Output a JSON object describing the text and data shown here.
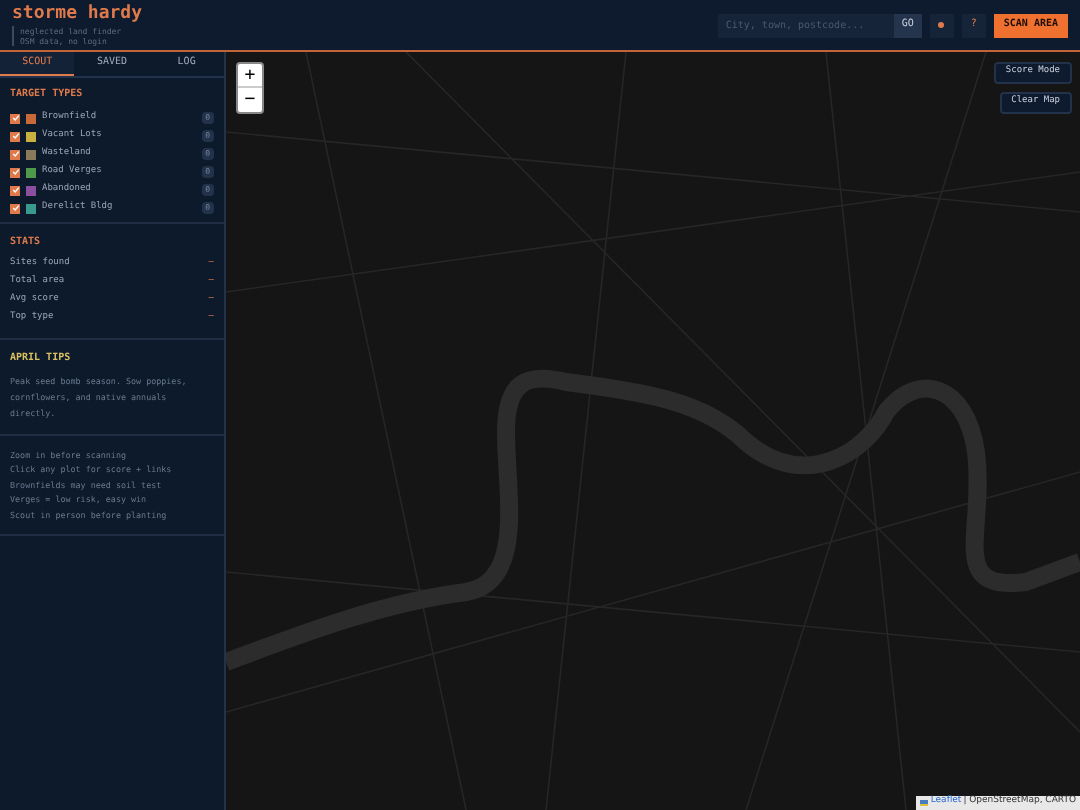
{
  "header": {
    "title": "storme hardy",
    "subtitle_lines": [
      "neglected land finder",
      "OSM data, no login"
    ],
    "search": {
      "placeholder": "City, town, postcode..."
    },
    "go_button": "GO",
    "help_button": "?",
    "scan_button": "SCAN AREA"
  },
  "tabs": [
    {
      "label": "SCOUT",
      "selected": true
    },
    {
      "label": "SAVED",
      "selected": false
    },
    {
      "label": "LOG",
      "selected": false
    }
  ],
  "target_types": {
    "title": "TARGET TYPES",
    "items": [
      {
        "label": "Brownfield",
        "checked": true,
        "color": "#c8693a",
        "count": "0"
      },
      {
        "label": "Vacant Lots",
        "checked": true,
        "color": "#c9b040",
        "count": "0"
      },
      {
        "label": "Wasteland",
        "checked": true,
        "color": "#8a7a5a",
        "count": "0"
      },
      {
        "label": "Road Verges",
        "checked": true,
        "color": "#4f9a4a",
        "count": "0"
      },
      {
        "label": "Abandoned",
        "checked": true,
        "color": "#8a4f9e",
        "count": "0"
      },
      {
        "label": "Derelict Bldg",
        "checked": true,
        "color": "#3a9a8e",
        "count": "0"
      }
    ]
  },
  "stats": {
    "title": "STATS",
    "rows": [
      {
        "label": "Sites found",
        "value": "–"
      },
      {
        "label": "Total area",
        "value": "–"
      },
      {
        "label": "Avg score",
        "value": "–"
      },
      {
        "label": "Top type",
        "value": "–"
      }
    ]
  },
  "tips": {
    "title": "APRIL TIPS",
    "text": "Peak seed bomb season. Sow poppies, cornflowers, and native annuals directly.",
    "hints": [
      "Zoom in before scanning",
      "Click any plot for score + links",
      "Brownfields may need soil test",
      "Verges = low risk, easy win",
      "Scout in person before planting"
    ]
  },
  "map": {
    "zoom_in": "+",
    "zoom_out": "−",
    "buttons": [
      "Score Mode",
      "Clear Map"
    ],
    "attribution_link": "Leaflet",
    "attribution_text": "| OpenStreetMap, CARTO"
  }
}
